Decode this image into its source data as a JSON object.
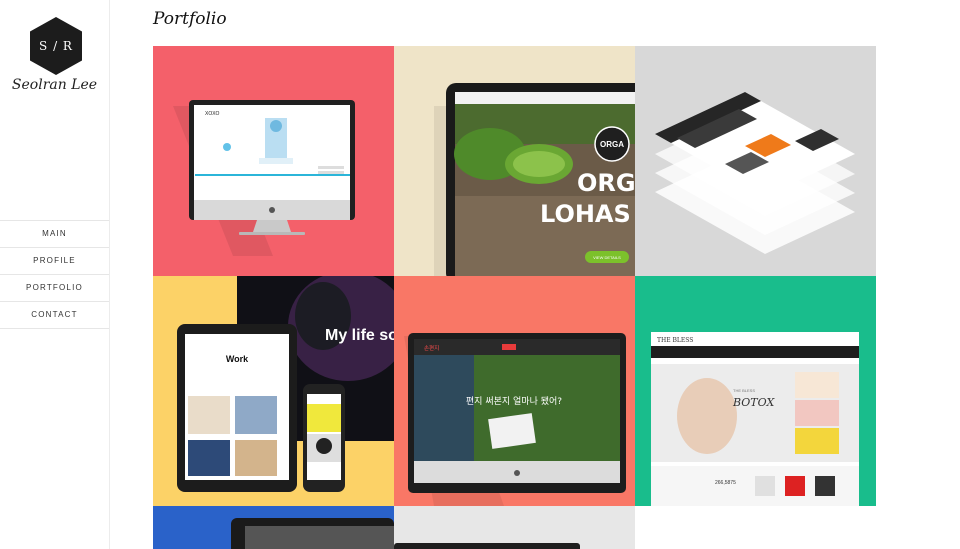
{
  "brand": {
    "logo_text": "S / R",
    "name": "Seolran Lee"
  },
  "nav": {
    "items": [
      {
        "label": "MAIN"
      },
      {
        "label": "PROFILE"
      },
      {
        "label": "PORTFOLIO"
      },
      {
        "label": "CONTACT"
      }
    ]
  },
  "page": {
    "title": "Portfolio"
  },
  "portfolio": {
    "tiles": [
      {
        "bg": "#f4606a",
        "screen_logo": "XOXO"
      },
      {
        "bg": "#efe4c8",
        "headline_1": "ORGA",
        "headline_2": "LOHAS L",
        "badge": "ORGA",
        "button": "VIEW DETAILS"
      },
      {
        "bg": "#d8d8d8"
      },
      {
        "bg": "#fcd267",
        "tablet_title": "Work",
        "overlay_text": "My life so"
      },
      {
        "bg": "#f97766",
        "screen_logo": "손편지",
        "screen_text": "편지 써본지 얼마나 됐어?"
      },
      {
        "bg": "#19bd8c",
        "site_logo": "THE BLESS",
        "hero_text": "BOTOX",
        "hero_sub": "THE BLESS",
        "price": "266,5875"
      },
      {
        "bg": "#2a62c9"
      },
      {
        "bg": "#e7e7e7"
      }
    ]
  }
}
